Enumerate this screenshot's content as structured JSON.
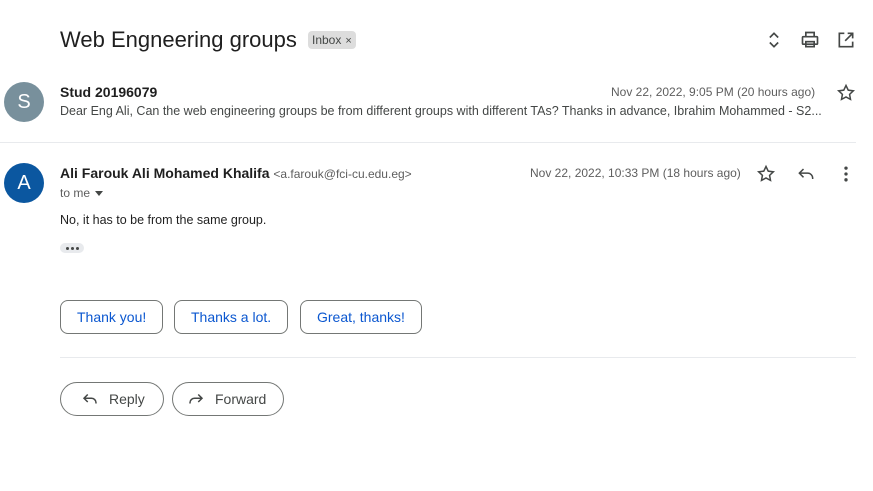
{
  "thread": {
    "subject": "Web Engneering groups",
    "label": "Inbox",
    "label_remove": "×"
  },
  "toolbar_icons": [
    "expand-collapse-icon",
    "print-icon",
    "open-in-new-window-icon"
  ],
  "messages": [
    {
      "avatar_letter": "S",
      "avatar_color": "#78909c",
      "sender": "Stud 20196079",
      "date": "Nov 22, 2022, 9:05 PM (20 hours ago)",
      "snippet": "Dear Eng Ali, Can the web engineering groups be from different groups with different TAs? Thanks in advance, Ibrahim Mohammed - S2..."
    },
    {
      "avatar_letter": "A",
      "avatar_color": "#0b57a0",
      "sender": "Ali Farouk Ali Mohamed Khalifa",
      "email": "<a.farouk@fci-cu.edu.eg>",
      "date": "Nov 22, 2022, 10:33 PM (18 hours ago)",
      "to": "to me",
      "body": "No, it has to be from the same group."
    }
  ],
  "smart_replies": [
    "Thank you!",
    "Thanks a lot.",
    "Great, thanks!"
  ],
  "actions": {
    "reply": "Reply",
    "forward": "Forward"
  },
  "colors": {
    "accent": "#0b57d0",
    "text": "#1f1f1f",
    "muted": "#5e5e5e"
  }
}
